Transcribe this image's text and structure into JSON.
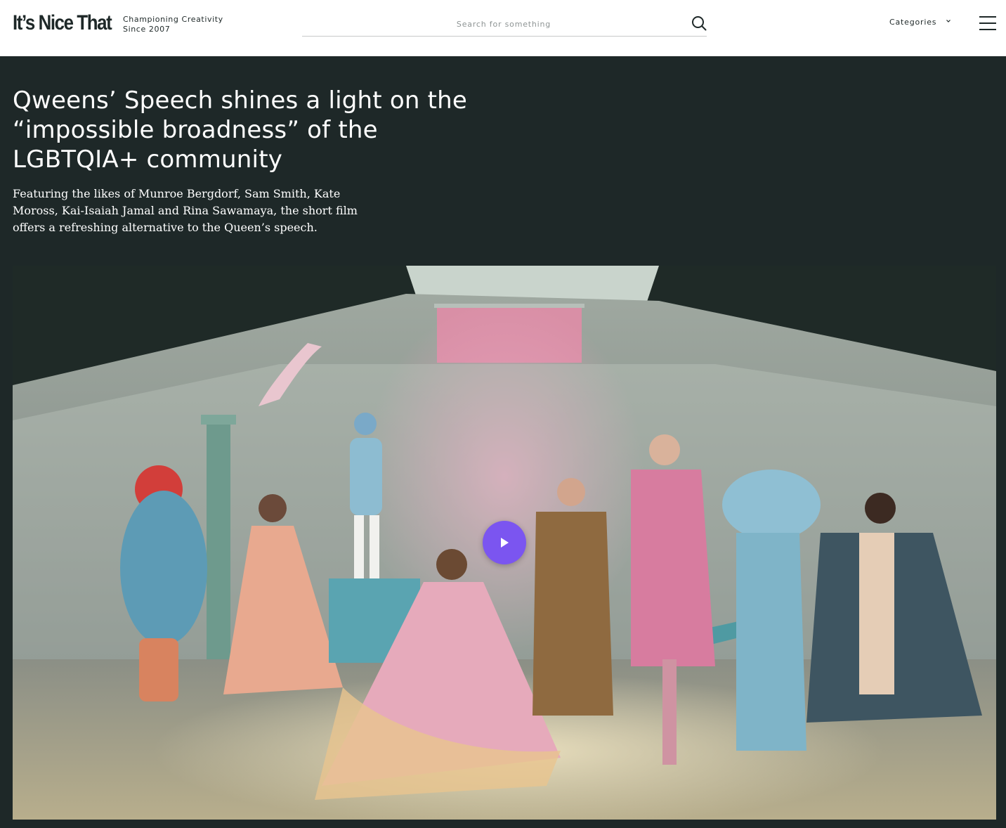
{
  "header": {
    "logo_text": "It’s Nice That",
    "tagline_line1": "Championing Creativity",
    "tagline_line2": "Since 2007",
    "search_placeholder": "Search for something",
    "search_icon": "search-icon",
    "categories_label": "Categories",
    "categories_icon": "chevron-down-icon",
    "menu_icon": "hamburger-menu-icon"
  },
  "article": {
    "headline": "Qweens’ Speech shines a light on the “impossible broadness” of the LGBTQIA+ community",
    "standfirst": "Featuring the likes of Munroe Bergdorf, Sam Smith, Kate Moross, Kai-Isaiah Jamal and Rina Sawamaya, the short film offers a refreshing alternative to the Queen’s speech."
  },
  "video": {
    "play_icon": "play-icon",
    "play_button_color": "#7b55f0"
  },
  "colors": {
    "page_background": "#1e2828",
    "header_background": "#ffffff",
    "text_on_dark": "#ffffff"
  }
}
